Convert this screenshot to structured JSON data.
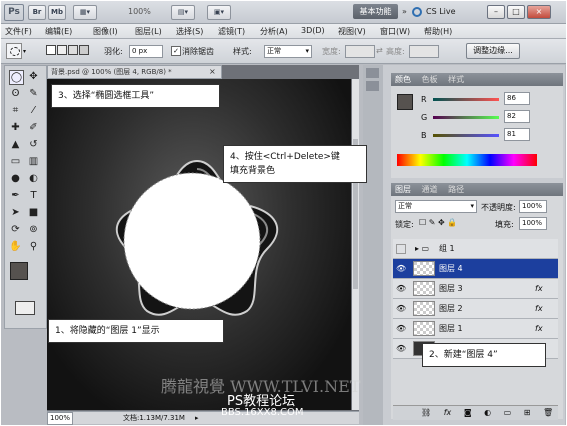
{
  "app_bar": {
    "logo": "Ps",
    "br_label": "Br",
    "mb_label": "Mb",
    "zoom": "100%",
    "workspace_button": "基本功能",
    "cs_live": "CS Live",
    "minimize": "–",
    "restore": "□",
    "close": "×"
  },
  "menu": [
    "文件(F)",
    "编辑(E)",
    "图像(I)",
    "图层(L)",
    "选择(S)",
    "滤镜(T)",
    "分析(A)",
    "3D(D)",
    "视图(V)",
    "窗口(W)",
    "帮助(H)"
  ],
  "options_bar": {
    "feather_label": "羽化:",
    "feather_value": "0 px",
    "antialias_label": "消除锯齿",
    "style_label": "样式:",
    "style_value": "正常",
    "width_label": "宽度:",
    "height_label": "高度:",
    "refine_button": "调整边缘..."
  },
  "document": {
    "tab_title": "背景.psd @ 100% (图层 4, RGB/8) *",
    "zoom_status": "100%",
    "doc_info": "文档:1.13M/7.31M"
  },
  "color_panel": {
    "tabs": [
      "颜色",
      "色板",
      "样式"
    ],
    "channels": [
      {
        "label": "R",
        "value": "86"
      },
      {
        "label": "G",
        "value": "82"
      },
      {
        "label": "B",
        "value": "81"
      }
    ]
  },
  "layers_panel": {
    "tabs": [
      "图层",
      "通道",
      "路径"
    ],
    "blend_mode": "正常",
    "opacity_label": "不透明度:",
    "opacity_value": "100%",
    "lock_label": "锁定:",
    "fill_label": "填充:",
    "fill_value": "100%",
    "layers": [
      {
        "name": "组 1",
        "type": "group",
        "selected": false
      },
      {
        "name": "图层 4",
        "type": "layer",
        "selected": true
      },
      {
        "name": "图层 3",
        "type": "layer",
        "selected": false,
        "fx": "fx"
      },
      {
        "name": "图层 2",
        "type": "layer",
        "selected": false,
        "fx": "fx"
      },
      {
        "name": "图层 1",
        "type": "layer",
        "selected": false,
        "fx": "fx"
      }
    ]
  },
  "callouts": {
    "step1": "1、将隐藏的“图层 1”显示",
    "step2": "2、新建“图层 4”",
    "step3": "3、选择“椭圆选框工具”",
    "step4_line1": "4、按住<Ctrl+Delete>键",
    "step4_line2": "填充背景色"
  },
  "watermark": {
    "brand": "腾龍視覺 WWW.TLVI.NET",
    "forum": "PS教程论坛",
    "forum_url": "BBS.16XX8.COM"
  }
}
